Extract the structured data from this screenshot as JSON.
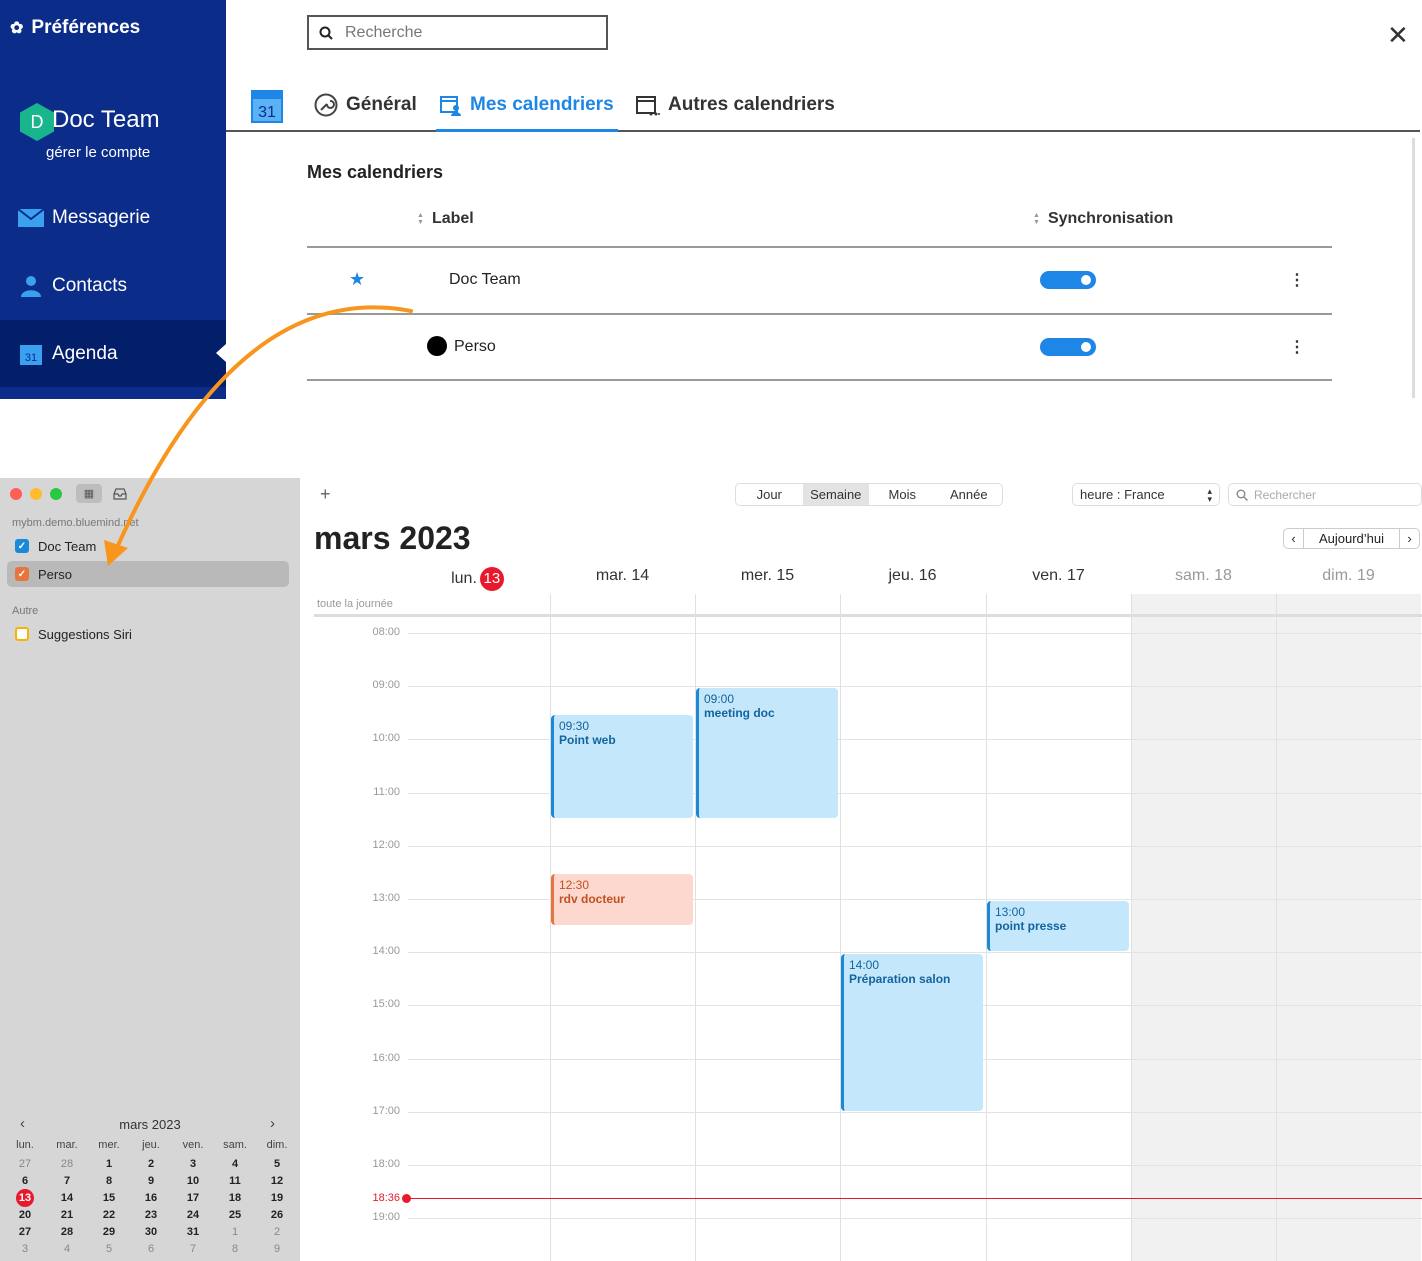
{
  "prefs": {
    "sidebar": {
      "title": "Préférences",
      "avatar_letter": "D",
      "user_name": "Doc Team",
      "manage_account": "gérer le compte",
      "items": [
        {
          "label": "Messagerie"
        },
        {
          "label": "Contacts"
        },
        {
          "label": "Agenda",
          "active": true
        }
      ]
    },
    "search": {
      "placeholder": "Recherche"
    },
    "close": "✕",
    "tabs": {
      "app_icon_day": "31",
      "items": [
        {
          "label": "Général"
        },
        {
          "label": "Mes calendriers",
          "active": true
        },
        {
          "label": "Autres calendriers"
        }
      ]
    },
    "section_title": "Mes calendriers",
    "table": {
      "columns": [
        "Label",
        "Synchronisation"
      ],
      "rows": [
        {
          "name": "Doc Team",
          "marker": "★",
          "sync": true
        },
        {
          "name": "Perso",
          "marker": "●",
          "sync": true
        }
      ],
      "more": "⋮"
    }
  },
  "mac": {
    "sidebar": {
      "account": "mybm.demo.bluemind.net",
      "calendars": [
        {
          "label": "Doc Team",
          "color": "#1a8ad8",
          "checked": true
        },
        {
          "label": "Perso",
          "color": "#e8743d",
          "checked": true,
          "selected": true
        }
      ],
      "other_group": "Autre",
      "other_calendars": [
        {
          "label": "Suggestions Siri",
          "color": "#f5b400",
          "checked": false
        }
      ]
    },
    "mini_calendar": {
      "title": "mars 2023",
      "prev": "‹",
      "next": "›",
      "weekdays": [
        "lun.",
        "mar.",
        "mer.",
        "jeu.",
        "ven.",
        "sam.",
        "dim."
      ],
      "weeks": [
        [
          "27",
          "28",
          "1",
          "2",
          "3",
          "4",
          "5"
        ],
        [
          "6",
          "7",
          "8",
          "9",
          "10",
          "11",
          "12"
        ],
        [
          "13",
          "14",
          "15",
          "16",
          "17",
          "18",
          "19"
        ],
        [
          "20",
          "21",
          "22",
          "23",
          "24",
          "25",
          "26"
        ],
        [
          "27",
          "28",
          "29",
          "30",
          "31",
          "1",
          "2"
        ],
        [
          "3",
          "4",
          "5",
          "6",
          "7",
          "8",
          "9"
        ]
      ],
      "today": "13"
    },
    "toolbar": {
      "add": "+",
      "views": [
        {
          "label": "Jour"
        },
        {
          "label": "Semaine",
          "active": true
        },
        {
          "label": "Mois"
        },
        {
          "label": "Année"
        }
      ],
      "timezone": "heure : France",
      "search_placeholder": "Rechercher"
    },
    "month_title": "mars 2023",
    "nav": {
      "prev": "‹",
      "today": "Aujourd’hui",
      "next": "›"
    },
    "days": [
      {
        "label": "lun.",
        "badge": "13"
      },
      {
        "label": "mar. 14"
      },
      {
        "label": "mer. 15"
      },
      {
        "label": "jeu. 16"
      },
      {
        "label": "ven. 17"
      },
      {
        "label": "sam. 18",
        "weekend": true
      },
      {
        "label": "dim. 19",
        "weekend": true
      }
    ],
    "all_day_label": "toute la journée",
    "hours": [
      "08:00",
      "09:00",
      "10:00",
      "11:00",
      "12:00",
      "13:00",
      "14:00",
      "15:00",
      "16:00",
      "17:00",
      "18:00",
      "19:00"
    ],
    "current_time": "18:36",
    "events": [
      {
        "day": 1,
        "start": "09:30",
        "end": "11:30",
        "time": "09:30",
        "title": "Point web",
        "color": "blue"
      },
      {
        "day": 2,
        "start": "09:00",
        "end": "11:30",
        "time": "09:00",
        "title": "meeting doc",
        "color": "blue"
      },
      {
        "day": 1,
        "start": "12:30",
        "end": "13:30",
        "time": "12:30",
        "title": "rdv docteur",
        "color": "orange"
      },
      {
        "day": 4,
        "start": "13:00",
        "end": "14:00",
        "time": "13:00",
        "title": "point presse",
        "color": "blue"
      },
      {
        "day": 3,
        "start": "14:00",
        "end": "17:00",
        "time": "14:00",
        "title": "Préparation salon",
        "color": "blue"
      }
    ]
  }
}
